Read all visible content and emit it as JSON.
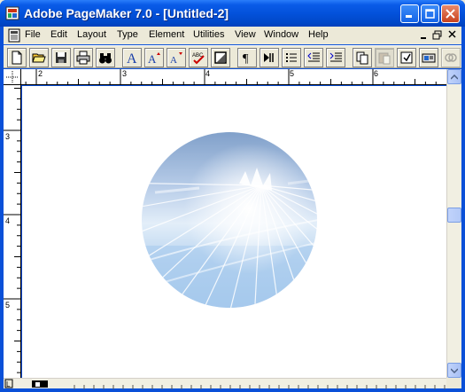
{
  "window": {
    "title": "Adobe PageMaker 7.0 - [Untitled-2]"
  },
  "menu": [
    {
      "key": "file",
      "label": "File"
    },
    {
      "key": "edit",
      "label": "Edit"
    },
    {
      "key": "layout",
      "label": "Layout"
    },
    {
      "key": "type",
      "label": "Type"
    },
    {
      "key": "element",
      "label": "Element"
    },
    {
      "key": "utilities",
      "label": "Utilities"
    },
    {
      "key": "view",
      "label": "View"
    },
    {
      "key": "window",
      "label": "Window"
    },
    {
      "key": "help",
      "label": "Help"
    }
  ],
  "toolbar": {
    "tools": [
      {
        "icon": "new-document-icon"
      },
      {
        "icon": "open-folder-icon"
      },
      {
        "icon": "save-disk-icon"
      },
      {
        "icon": "print-icon"
      },
      {
        "icon": "find-binoculars-icon"
      },
      {
        "icon": "character-format-icon"
      },
      {
        "icon": "increase-font-size-icon"
      },
      {
        "icon": "decrease-font-size-icon"
      },
      {
        "icon": "spelling-check-icon"
      },
      {
        "icon": "fill-and-stroke-icon"
      },
      {
        "icon": "pilcrow-icon"
      },
      {
        "icon": "text-wrap-icon"
      },
      {
        "icon": "bullets-icon"
      },
      {
        "icon": "decrease-indent-icon"
      },
      {
        "icon": "increase-indent-icon"
      },
      {
        "icon": "copy-icon"
      },
      {
        "icon": "paste-icon"
      },
      {
        "icon": "place-icon"
      },
      {
        "icon": "export-icon"
      },
      {
        "icon": "links-icon"
      }
    ]
  },
  "rulers": {
    "horizontal_labels": [
      "2",
      "3",
      "4",
      "5",
      "6"
    ],
    "vertical_labels": [
      "3",
      "4",
      "5"
    ]
  },
  "colors": {
    "title_bar": "#0352db",
    "chrome": "#ece9d8",
    "canvas": "#ffffff"
  }
}
